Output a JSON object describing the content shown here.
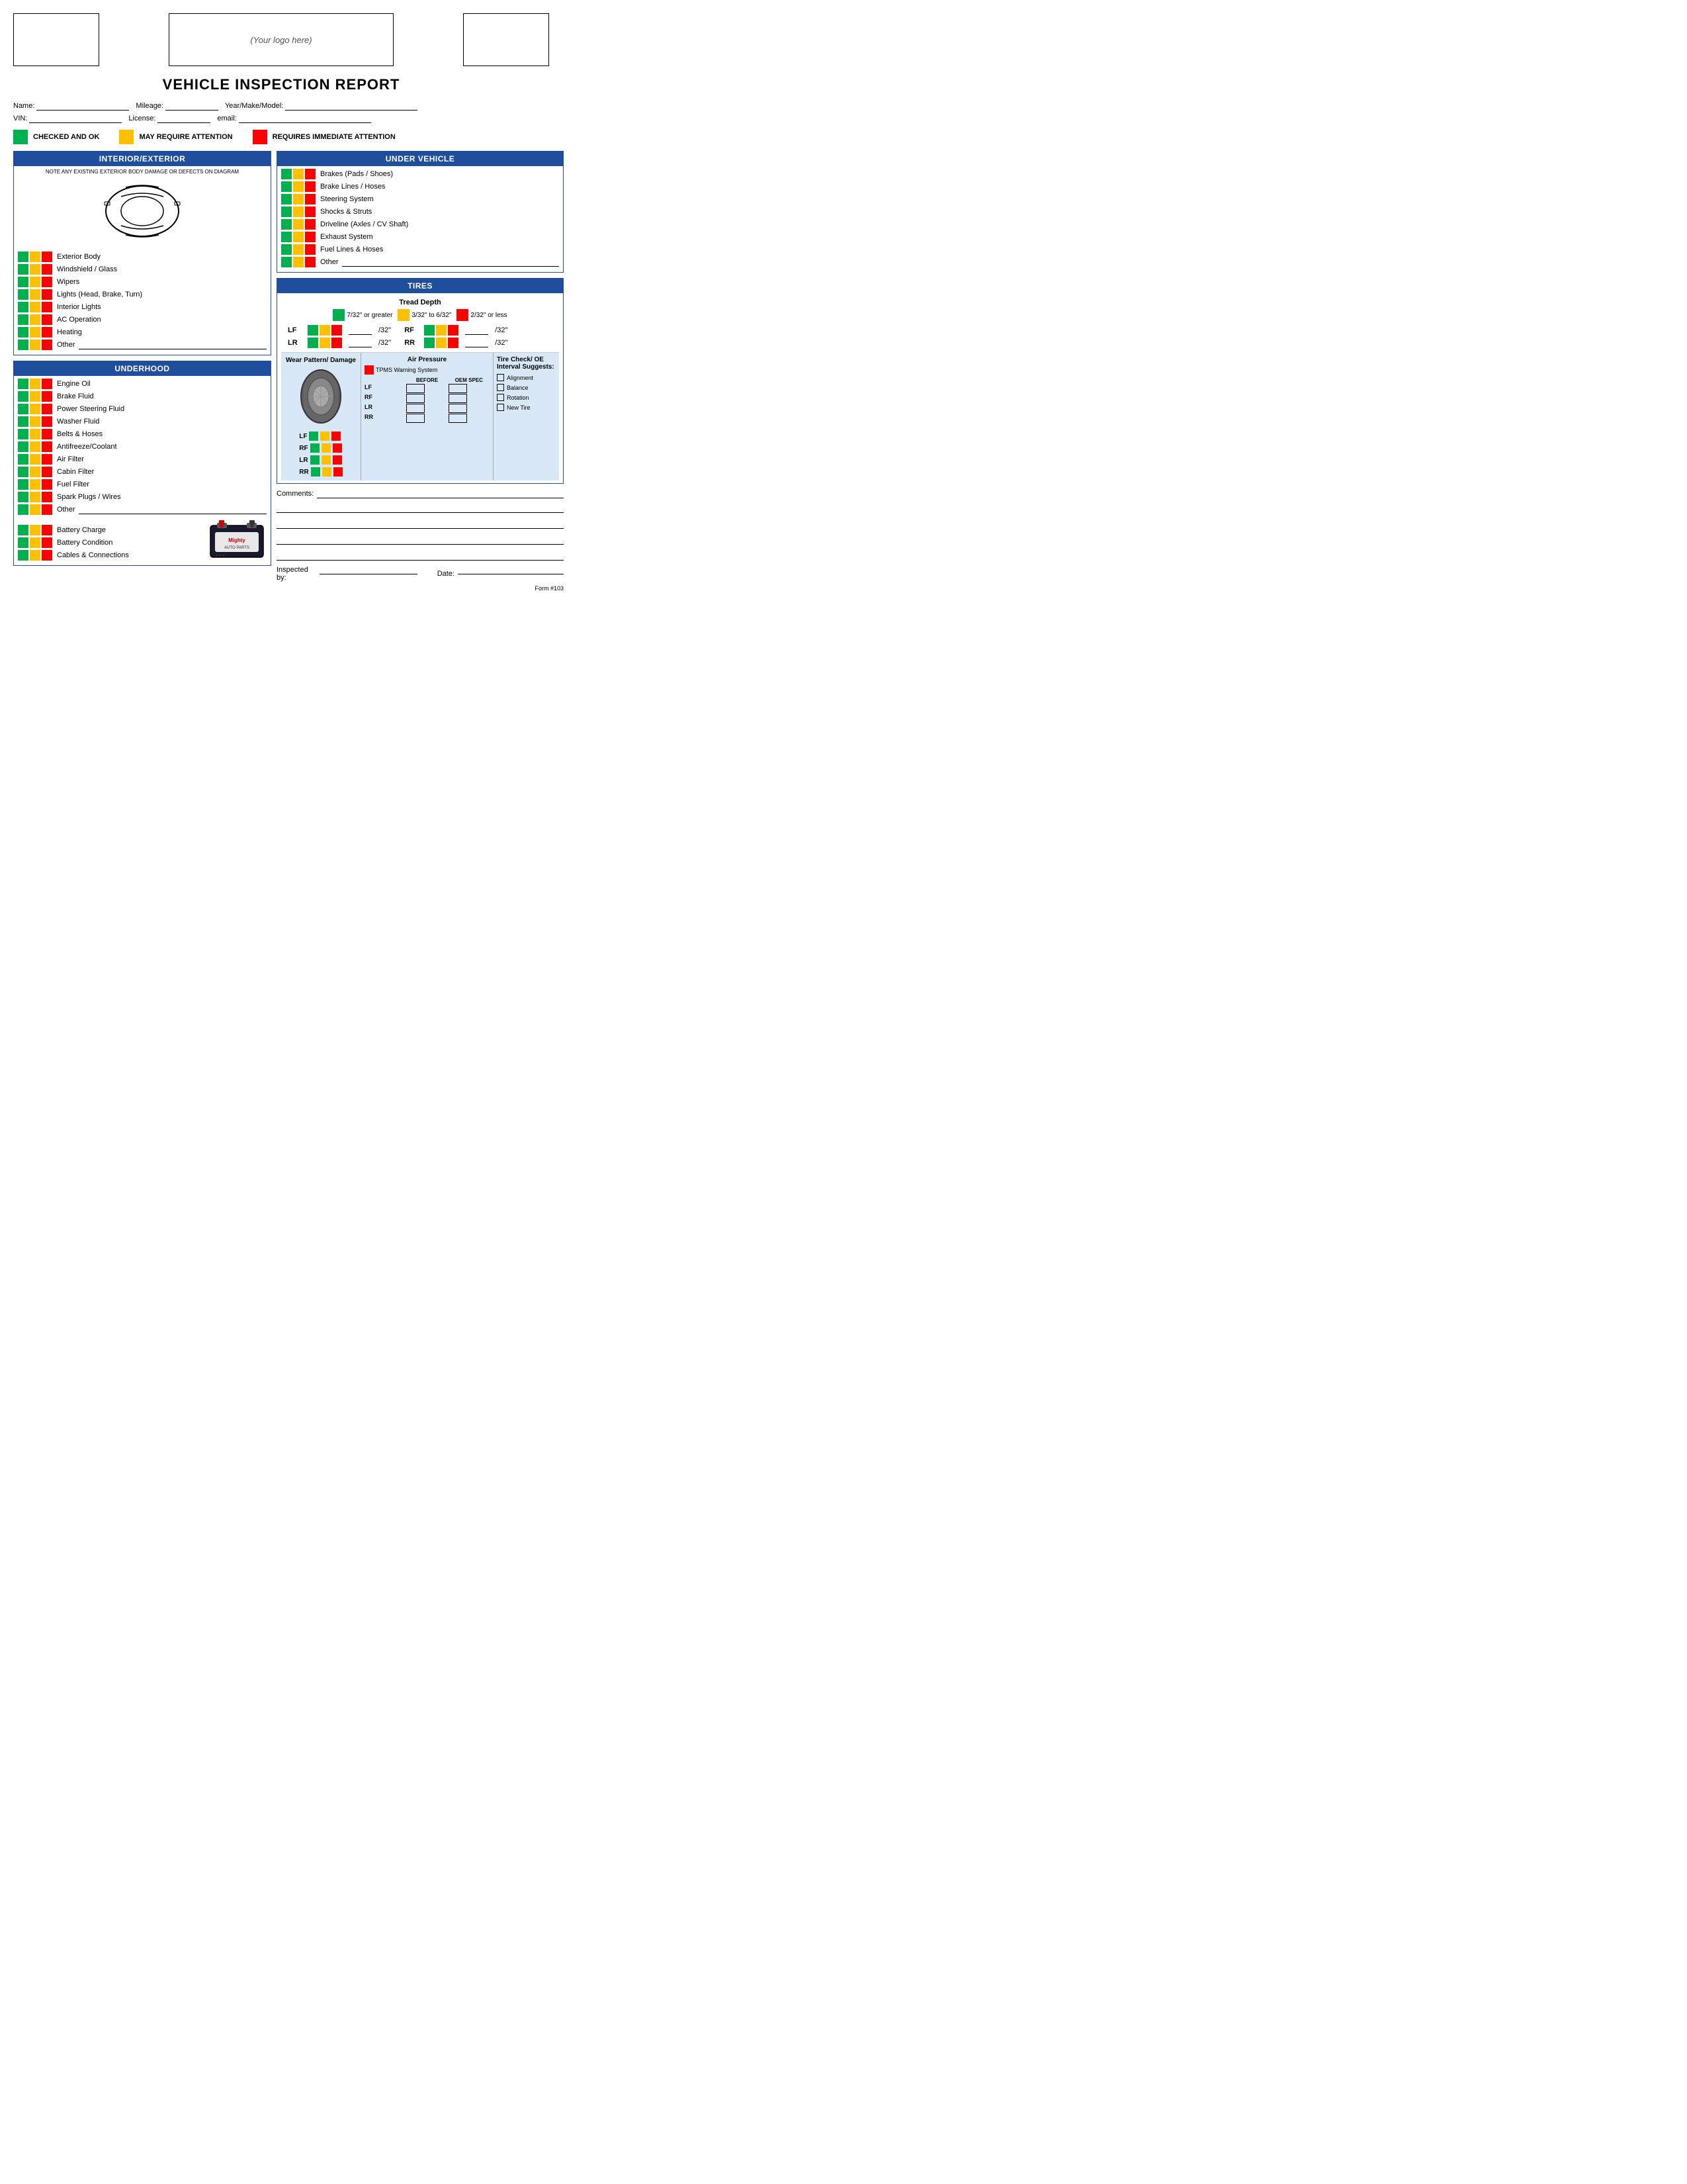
{
  "header": {
    "logo_text": "(Your logo here)"
  },
  "title": "VEHICLE INSPECTION REPORT",
  "fields": {
    "name_label": "Name:",
    "mileage_label": "Mileage:",
    "year_label": "Year/Make/Model:",
    "vin_label": "VIN:",
    "license_label": "License:",
    "email_label": "email:"
  },
  "legend": {
    "green_label": "CHECKED AND OK",
    "yellow_label": "MAY REQUIRE ATTENTION",
    "red_label": "REQUIRES IMMEDIATE ATTENTION"
  },
  "interior_exterior": {
    "title": "INTERIOR/EXTERIOR",
    "note": "NOTE ANY EXISTING EXTERIOR BODY DAMAGE OR DEFECTS ON DIAGRAM",
    "items": [
      "Exterior Body",
      "Windshield / Glass",
      "Wipers",
      "Lights (Head, Brake, Turn)",
      "Interior Lights",
      "AC Operation",
      "Heating",
      "Other"
    ]
  },
  "underhood": {
    "title": "UNDERHOOD",
    "items": [
      "Engine Oil",
      "Brake Fluid",
      "Power Steering Fluid",
      "Washer Fluid",
      "Belts & Hoses",
      "Antifreeze/Coolant",
      "Air Filter",
      "Cabin Filter",
      "Fuel Filter",
      "Spark Plugs / Wires",
      "Other"
    ],
    "battery_items": [
      "Battery Charge",
      "Battery Condition",
      "Cables & Connections"
    ]
  },
  "under_vehicle": {
    "title": "UNDER VEHICLE",
    "items": [
      "Brakes (Pads / Shoes)",
      "Brake Lines / Hoses",
      "Steering System",
      "Shocks & Struts",
      "Driveline (Axles / CV Shaft)",
      "Exhaust System",
      "Fuel Lines & Hoses",
      "Other"
    ]
  },
  "tires": {
    "title": "TIRES",
    "tread_depth_title": "Tread Depth",
    "green_label": "7/32\" or greater",
    "yellow_label": "3/32\" to 6/32\"",
    "red_label": "2/32\" or less",
    "positions": [
      "LF",
      "RF",
      "LR",
      "RR"
    ],
    "wear_pattern_label": "Wear Pattern/ Damage",
    "air_pressure_title": "Air Pressure",
    "tpms_label": "TPMS Warning System",
    "before_label": "BEFORE",
    "oemspec_label": "OEM SPEC",
    "tire_check_title": "Tire Check/ OE Interval Suggests:",
    "tire_check_items": [
      "Alignment",
      "Balance",
      "Rotation",
      "New Tire"
    ]
  },
  "comments": {
    "label": "Comments:",
    "lines": 5
  },
  "inspected": {
    "label": "Inspected by:",
    "date_label": "Date:"
  },
  "form_number": "Form #103"
}
